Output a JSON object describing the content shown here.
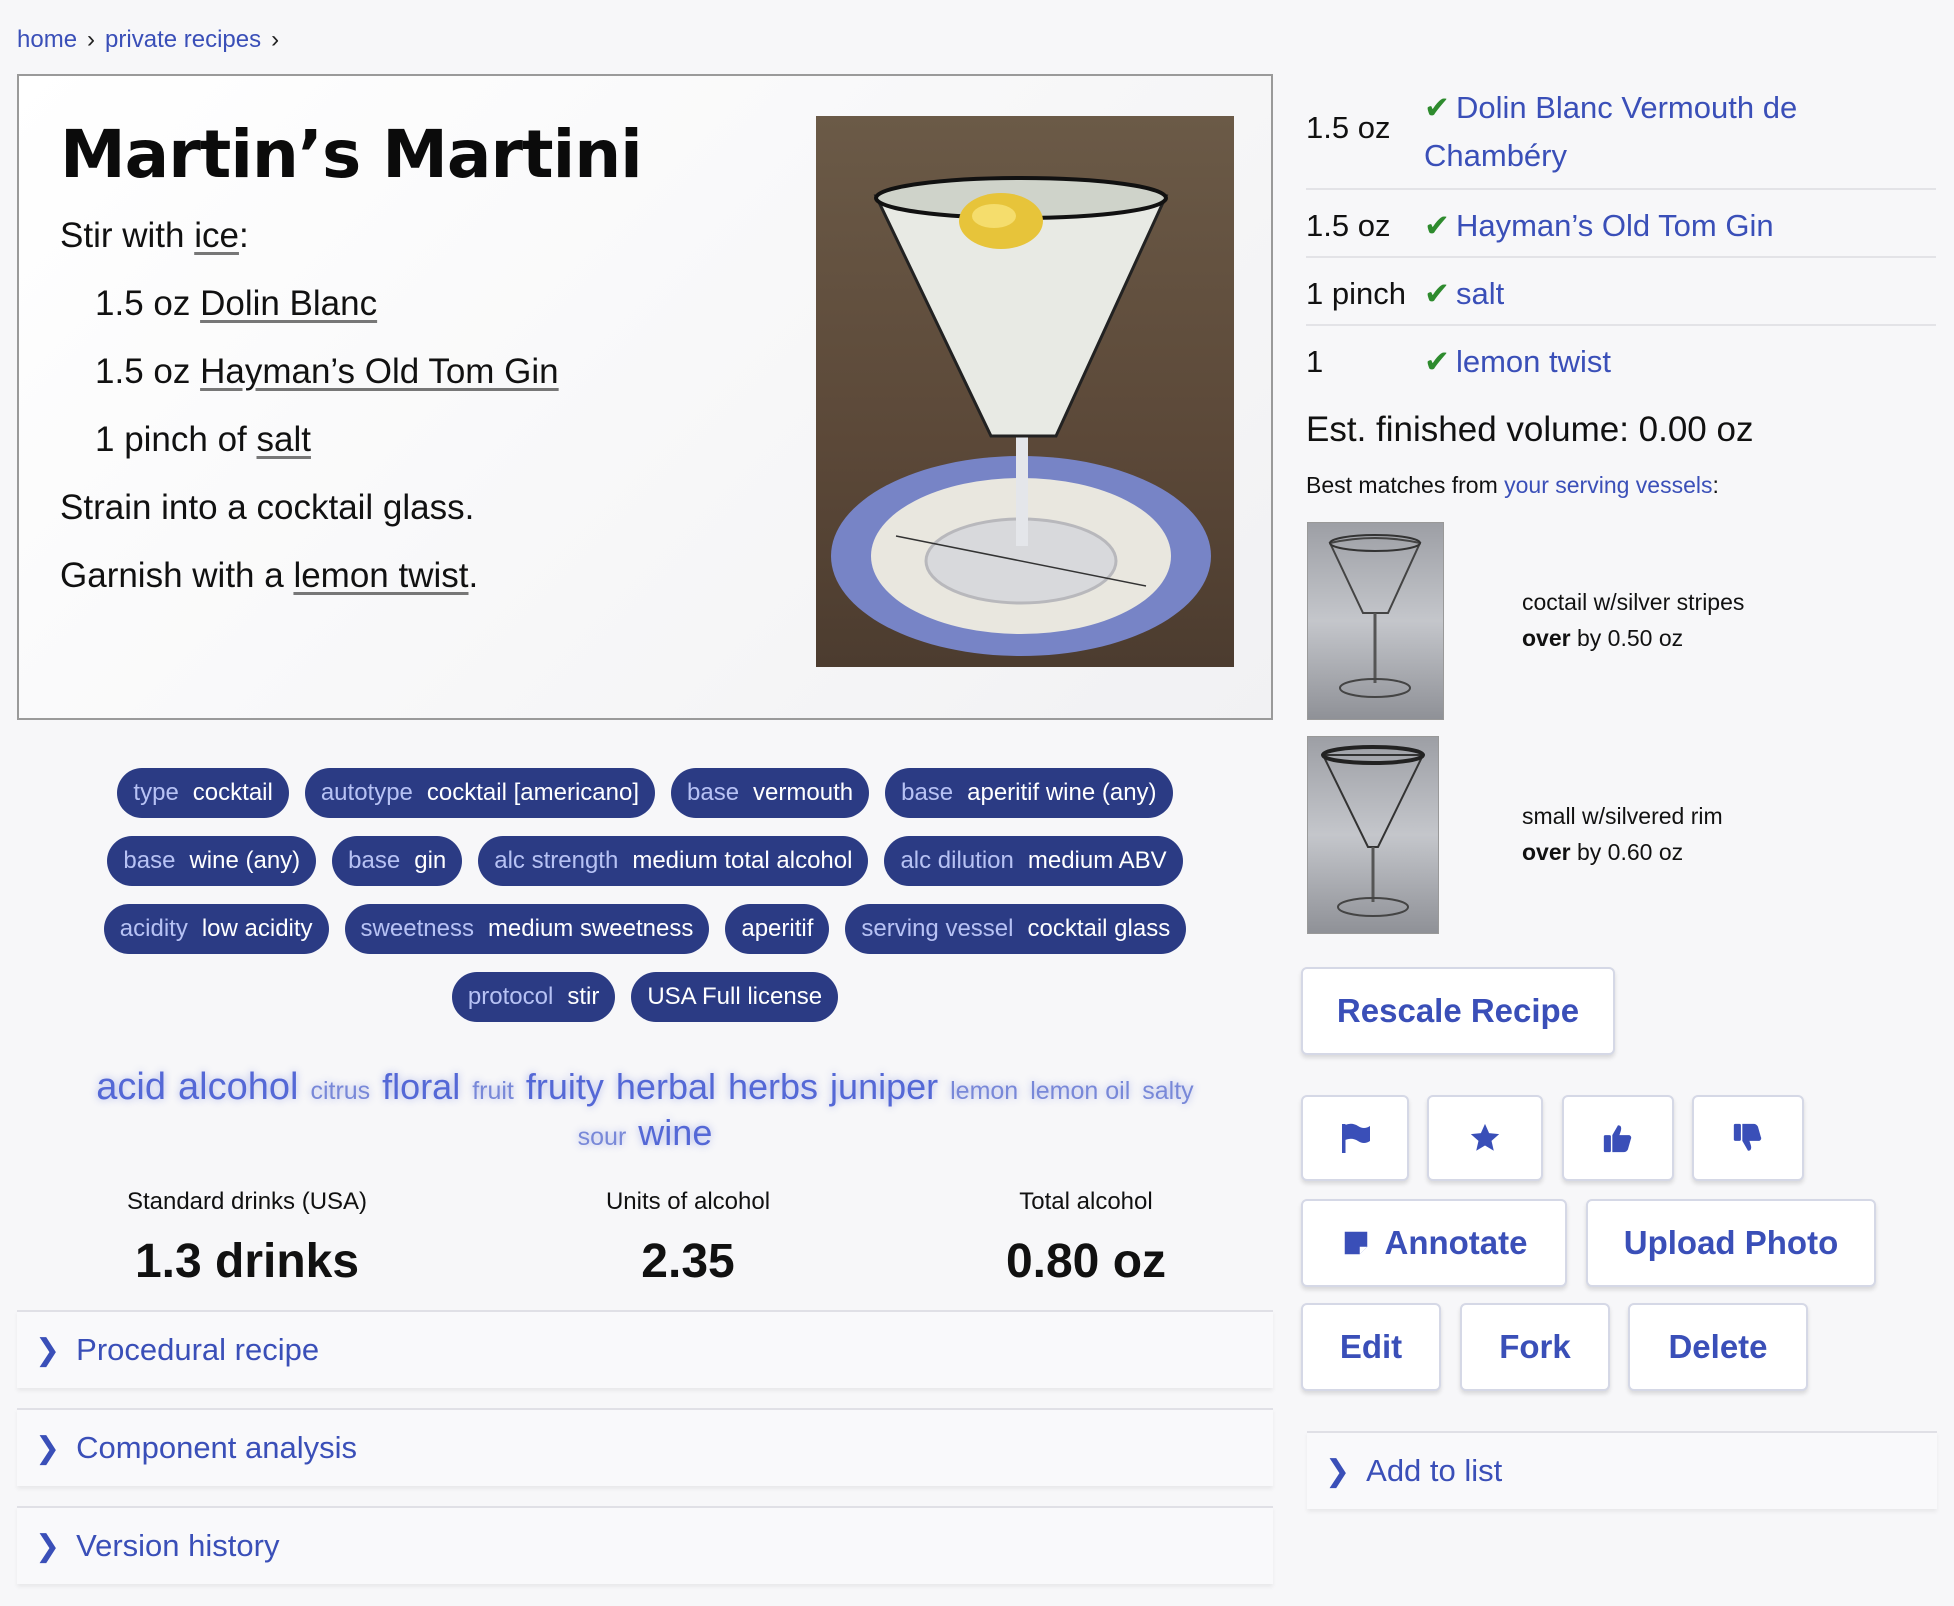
{
  "breadcrumb": [
    "home",
    "private recipes"
  ],
  "recipe": {
    "title": "Martin’s Martini",
    "steps": {
      "s1_pre": "Stir with ",
      "s1_link": "ice",
      "s1_post": ":",
      "s2_pre": "1.5 oz ",
      "s2_link": "Dolin Blanc",
      "s3_pre": "1.5 oz ",
      "s3_link": "Hayman’s Old Tom Gin",
      "s4_pre": "1 pinch of ",
      "s4_link": "salt",
      "s5": "Strain into a cocktail glass.",
      "s6_pre": "Garnish with a ",
      "s6_link": "lemon twist",
      "s6_post": "."
    }
  },
  "tags": [
    {
      "k": "type",
      "v": "cocktail"
    },
    {
      "k": "autotype",
      "v": "cocktail [americano]"
    },
    {
      "k": "base",
      "v": "vermouth"
    },
    {
      "k": "base",
      "v": "aperitif wine (any)"
    },
    {
      "k": "base",
      "v": "wine (any)"
    },
    {
      "k": "base",
      "v": "gin"
    },
    {
      "k": "alc strength",
      "v": "medium total alcohol"
    },
    {
      "k": "alc dilution",
      "v": "medium ABV"
    },
    {
      "k": "acidity",
      "v": "low acidity"
    },
    {
      "k": "sweetness",
      "v": "medium sweetness"
    },
    {
      "k": "",
      "v": "aperitif"
    },
    {
      "k": "serving vessel",
      "v": "cocktail glass"
    },
    {
      "k": "protocol",
      "v": "stir"
    },
    {
      "k": "",
      "v": "USA Full license"
    }
  ],
  "flavors": [
    "acid",
    "alcohol",
    "citrus",
    "floral",
    "fruit",
    "fruity",
    "herbal",
    "herbs",
    "juniper",
    "lemon",
    "lemon oil",
    "salty",
    "sour",
    "wine"
  ],
  "stats": [
    {
      "label": "Standard drinks (USA)",
      "value": "1.3 drinks"
    },
    {
      "label": "Units of alcohol",
      "value": "2.35"
    },
    {
      "label": "Total alcohol",
      "value": "0.80 oz"
    }
  ],
  "accordions": [
    "Procedural recipe",
    "Component analysis",
    "Version history"
  ],
  "ingredients": [
    {
      "amount": "1.5 oz",
      "name": "Dolin Blanc Vermouth de Chambéry"
    },
    {
      "amount": "1.5 oz",
      "name": "Hayman’s Old Tom Gin"
    },
    {
      "amount": "1 pinch",
      "name": "salt"
    },
    {
      "amount": "1",
      "name": "lemon twist"
    }
  ],
  "check_glyph": "✔",
  "volume": "Est. finished volume: 0.00 oz",
  "best_matches": {
    "pre": "Best matches from ",
    "link": "your serving vessels",
    "post": ":"
  },
  "vessels": [
    {
      "name": "coctail w/silver stripes",
      "over": "over",
      "by": " by 0.50 oz"
    },
    {
      "name": "small w/silvered rim",
      "over": "over",
      "by": " by 0.60 oz"
    }
  ],
  "buttons": {
    "rescale": "Rescale Recipe",
    "annotate": "Annotate",
    "upload": "Upload Photo",
    "edit": "Edit",
    "fork": "Fork",
    "delete": "Delete",
    "add_to_list": "Add to list"
  },
  "icons": [
    "flag-icon",
    "star-icon",
    "thumbs-up-icon",
    "thumbs-down-icon",
    "note-icon",
    "chevron-right-icon"
  ],
  "colors": {
    "accent": "#3a4fb8",
    "tag_bg": "#2b3b84",
    "check": "#2e8b2e"
  }
}
